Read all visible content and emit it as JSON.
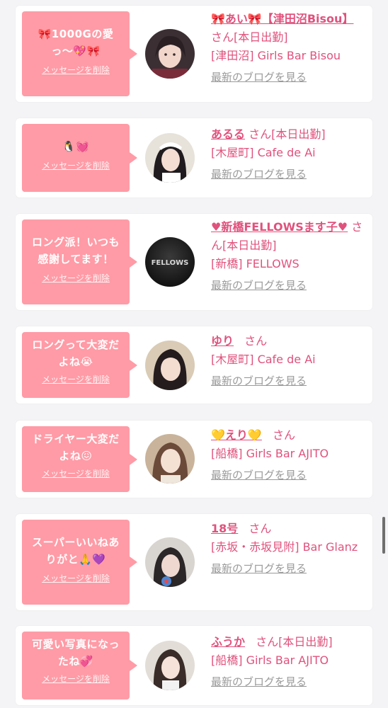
{
  "common": {
    "delete_label": "メッセージを削除",
    "blog_label": "最新のブログを見る",
    "san": "さん"
  },
  "colors": {
    "bubble": "#ff9ba6",
    "accent": "#e0527d",
    "muted": "#9a9a9a"
  },
  "cards": [
    {
      "message": "🎀1000Gの愛っ〜💖🎀",
      "name": "🎀あい🎀【津田沼Bisou】",
      "status": "[本日出勤]",
      "shop": "[津田沼] Girls Bar Bisou",
      "avatar_icon": "girl-photo-avatar"
    },
    {
      "message": "🐧💓",
      "name": "あるる",
      "status": "[本日出勤]",
      "shop": "[木屋町] Cafe de Ai",
      "avatar_icon": "maid-photo-avatar"
    },
    {
      "message": "ロング派！いつも感謝してます！",
      "name": "♥新橋FELLOWSます子♥",
      "status": "[本日出勤]",
      "shop": "[新橋] FELLOWS",
      "avatar_icon": "fellows-logo-avatar",
      "avatar_text": "FELLOWS"
    },
    {
      "message": "ロングって大変だよね😭",
      "name": "ゆり",
      "status": "",
      "shop": "[木屋町] Cafe de Ai",
      "avatar_icon": "girl-photo-avatar"
    },
    {
      "message": "ドライヤー大変だよね😖",
      "name": "💛えり💛",
      "status": "",
      "shop": "[船橋] Girls Bar AJITO",
      "avatar_icon": "girl-photo-avatar"
    },
    {
      "message": "スーパーいいねありがと🙏💜",
      "name": "18号",
      "status": "",
      "shop": "[赤坂・赤坂見附] Bar Glanz",
      "avatar_icon": "girl-photo-avatar"
    },
    {
      "message": "可愛い写真になったね💞",
      "name": "ふうか",
      "status": "[本日出勤]",
      "shop": "[船橋] Girls Bar AJITO",
      "avatar_icon": "girl-photo-avatar"
    }
  ]
}
